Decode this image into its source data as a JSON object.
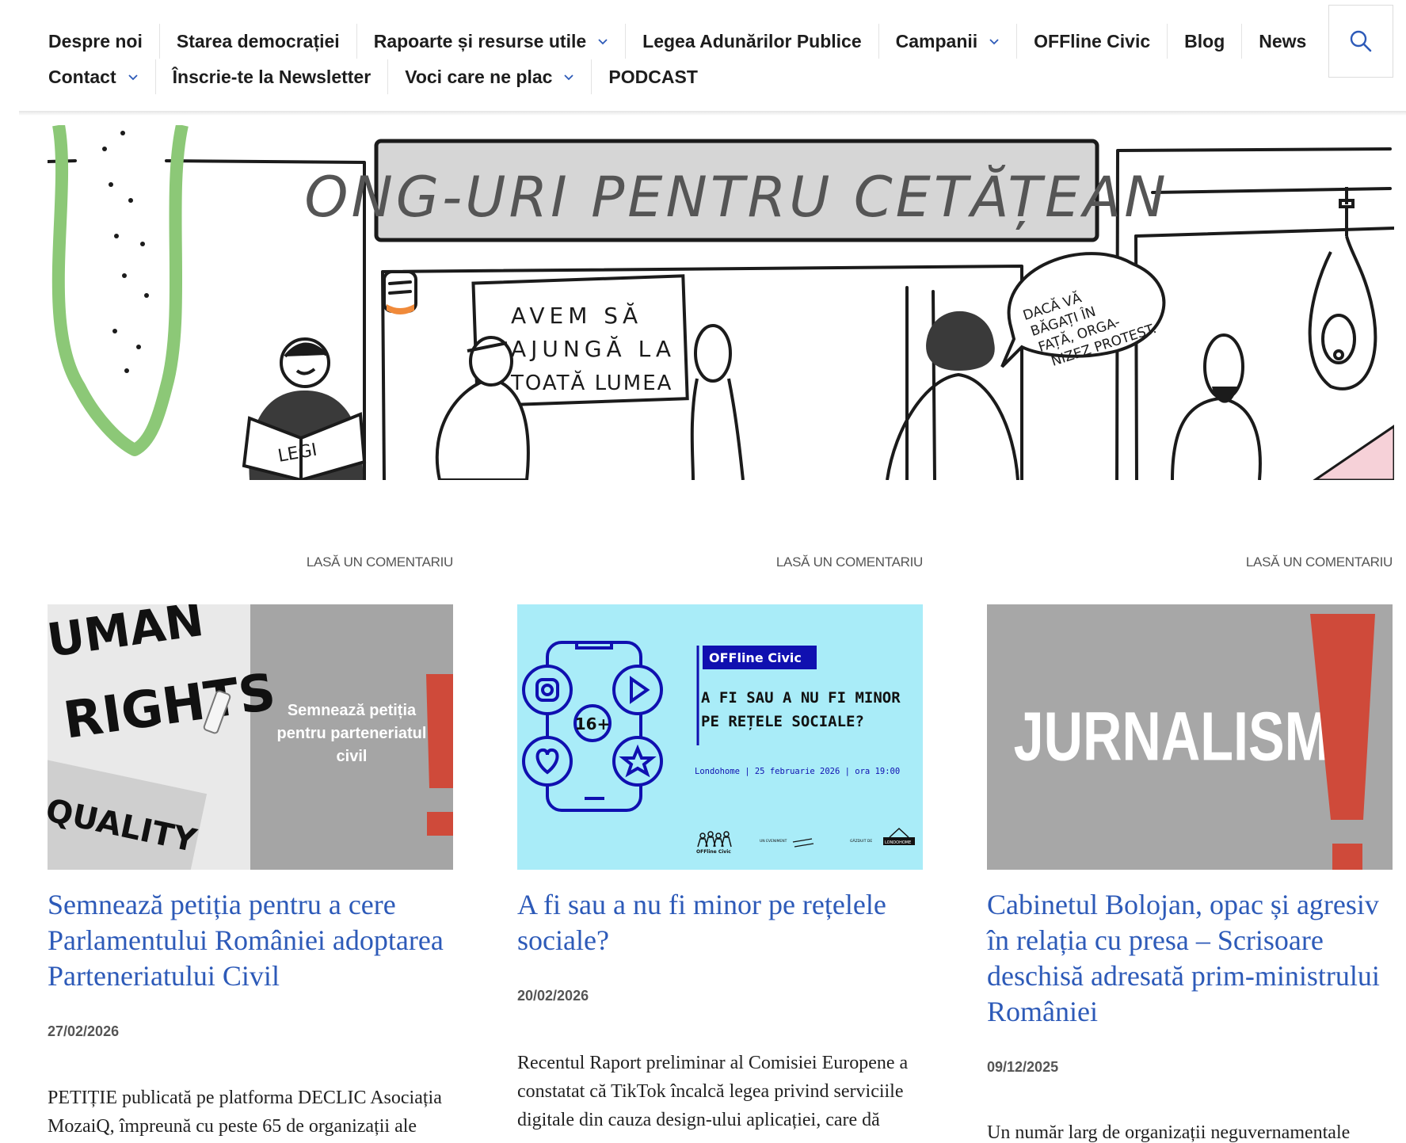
{
  "nav": {
    "row1": [
      {
        "label": "Despre noi",
        "dropdown": false
      },
      {
        "label": "Starea democrației",
        "dropdown": false
      },
      {
        "label": "Rapoarte și resurse utile",
        "dropdown": true
      },
      {
        "label": "Legea Adunărilor Publice",
        "dropdown": false
      },
      {
        "label": "Campanii",
        "dropdown": true
      },
      {
        "label": "OFFline Civic",
        "dropdown": false
      },
      {
        "label": "Blog",
        "dropdown": false
      },
      {
        "label": "News",
        "dropdown": false
      }
    ],
    "row2": [
      {
        "label": "Contact",
        "dropdown": true
      },
      {
        "label": "Înscrie-te la Newsletter",
        "dropdown": false
      },
      {
        "label": "Voci care ne plac",
        "dropdown": true
      },
      {
        "label": "PODCAST",
        "dropdown": false
      }
    ],
    "search_icon": "search-icon",
    "chevron_icon": "chevron-down-icon"
  },
  "hero": {
    "sign": "ONG-URI PENTRU CETĂȚEAN",
    "board": [
      "AVEM SĂ",
      "AJUNGĂ LA",
      "TOATĂ LUMEA"
    ],
    "paper": "LEGI",
    "bubble": [
      "DACĂ VĂ",
      "BĂGAȚI ÎN",
      "FAȚĂ, ORGA-",
      "NIZEZ PROTEST."
    ]
  },
  "posts": [
    {
      "comment_link": "LASĂ UN COMENTARIU",
      "thumb": {
        "lines": [
          "Semnează petiția",
          "pentru parteneriatul",
          "civil"
        ],
        "bg_text_1": "UMAN",
        "bg_text_2": "RIGHTS",
        "bg_text_3": "QUALITY"
      },
      "title": "Semnează petiția pentru a cere Parlamentului României adoptarea Parteneriatului Civil",
      "date": "27/02/2026",
      "excerpt_lines": [
        "PETIȚIE publicată pe platforma DECLIC Asociația",
        "MozaiQ, împreună cu peste 65 de organizații ale"
      ]
    },
    {
      "comment_link": "LASĂ UN COMENTARIU",
      "thumb": {
        "badge": "OFFline Civic",
        "heading_1": "A FI SAU A NU FI MINOR",
        "heading_2": "PE REȚELE SOCIALE?",
        "info": "Londohome | 25 februarie 2026 | ora 19:00",
        "age": "16+",
        "logo_1": "OFFline Civic",
        "logo_2": "UN EVENIMENT",
        "logo_3": "GĂZDUIT DE",
        "logo_4": "LONDOHOME"
      },
      "title": "A fi sau a nu fi minor pe rețelele sociale?",
      "date": "20/02/2026",
      "excerpt_lines": [
        "Recentul Raport preliminar al Comisiei Europene a",
        "constatat că TikTok încalcă legea privind serviciile",
        "digitale din cauza design-ului aplicației, care dă"
      ]
    },
    {
      "comment_link": "LASĂ UN COMENTARIU",
      "thumb": {
        "word": "JURNALISM"
      },
      "title": "Cabinetul Bolojan, opac și agresiv în relația cu presa – Scrisoare deschisă adresată prim-ministrului României",
      "date": "09/12/2025",
      "excerpt_lines": [
        "Un număr larg de organizații neguvernamentale"
      ]
    }
  ],
  "colors": {
    "link": "#2d5ab8",
    "accent_red": "#cf4a3a",
    "cyan_bg": "#a9ecf8",
    "navy": "#1010b0",
    "gray_thumb": "#a7a7a7"
  }
}
